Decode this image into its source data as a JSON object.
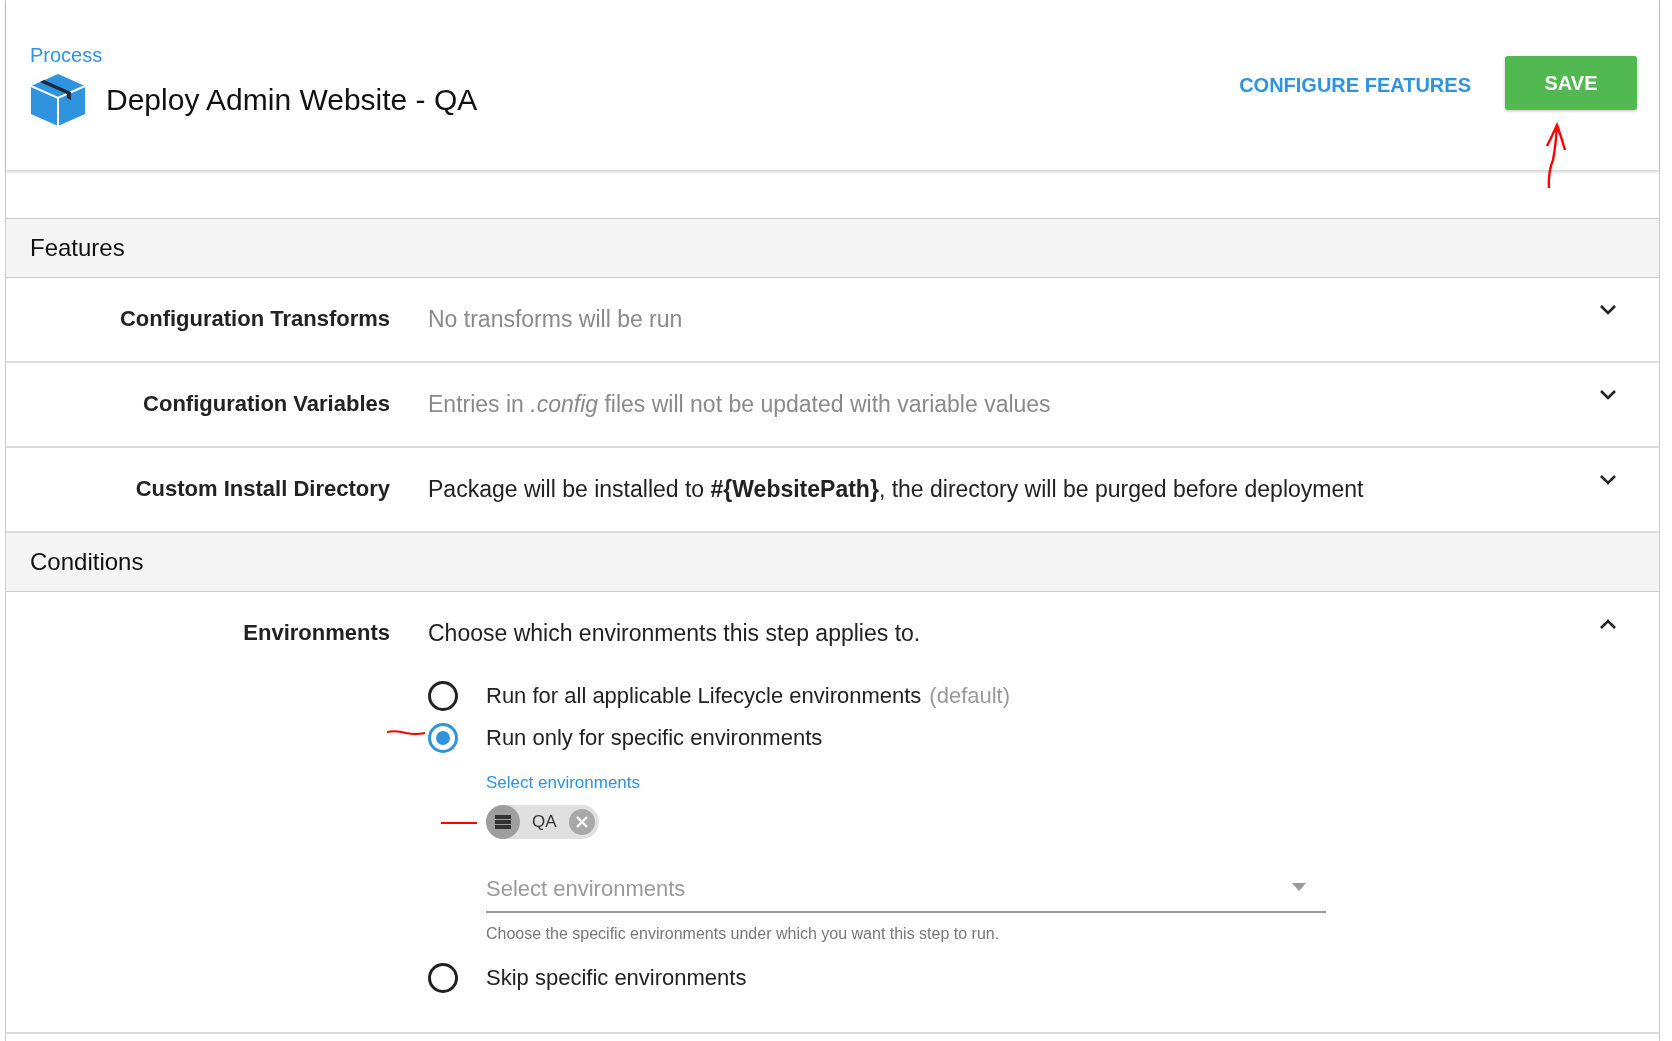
{
  "header": {
    "breadcrumb": "Process",
    "title": "Deploy Admin Website - QA",
    "configure_link": "CONFIGURE FEATURES",
    "save_button": "SAVE"
  },
  "sections": [
    {
      "title": "Features",
      "rows": [
        {
          "label": "Configuration Transforms",
          "value": "No transforms will be run",
          "muted": true,
          "expanded": false
        },
        {
          "label": "Configuration Variables",
          "value": "Entries in *.config* files will not be updated with variable values",
          "muted": true,
          "expanded": false
        },
        {
          "label": "Custom Install Directory",
          "value": "Package will be installed to **#{WebsitePath}**, the directory will be purged before deployment",
          "muted": false,
          "expanded": false
        }
      ]
    },
    {
      "title": "Conditions",
      "rows": [
        {
          "label": "Environments",
          "value": "Choose which environments this step applies to.",
          "muted": false,
          "expanded": true
        }
      ]
    }
  ],
  "environments": {
    "options": [
      {
        "label": "Run for all applicable Lifecycle environments",
        "note": "(default)",
        "selected": false
      },
      {
        "label": "Run only for specific environments",
        "selected": true
      },
      {
        "label": "Skip specific environments",
        "selected": false
      }
    ],
    "select_label": "Select environments",
    "chips": [
      {
        "label": "QA"
      }
    ],
    "field": {
      "placeholder": "Select environments",
      "helper": "Choose the specific environments under which you want this step to run."
    }
  }
}
